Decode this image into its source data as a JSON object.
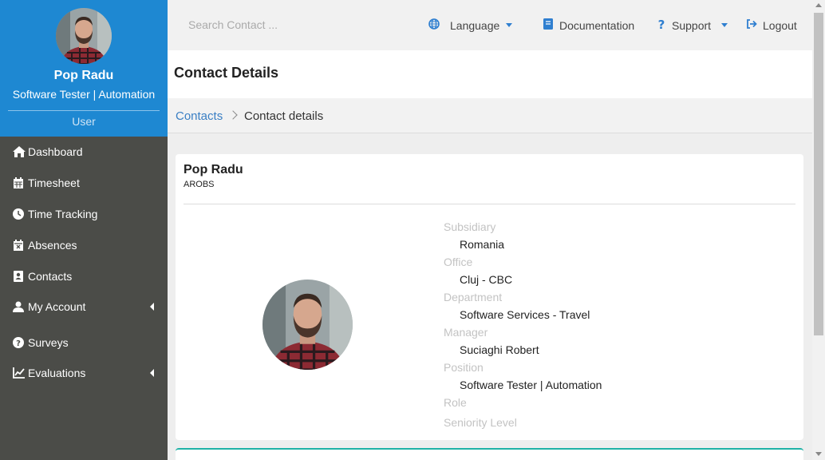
{
  "user": {
    "name": "Pop Radu",
    "role": "Software Tester | Automation",
    "type": "User"
  },
  "sidebar": {
    "items": [
      {
        "label": "Dashboard",
        "icon": "home-icon"
      },
      {
        "label": "Timesheet",
        "icon": "calendar-icon"
      },
      {
        "label": "Time Tracking",
        "icon": "clock-icon"
      },
      {
        "label": "Absences",
        "icon": "calendar-x-icon"
      },
      {
        "label": "Contacts",
        "icon": "address-book-icon"
      },
      {
        "label": "My Account",
        "icon": "user-icon",
        "expandable": true
      },
      {
        "label": "Surveys",
        "icon": "question-circle-icon"
      },
      {
        "label": "Evaluations",
        "icon": "line-chart-icon",
        "expandable": true
      }
    ]
  },
  "topbar": {
    "search_placeholder": "Search Contact ...",
    "language_label": "Language",
    "documentation_label": "Documentation",
    "support_label": "Support",
    "logout_label": "Logout"
  },
  "page": {
    "title": "Contact Details"
  },
  "breadcrumb": {
    "parent": "Contacts",
    "current": "Contact details"
  },
  "contact": {
    "name": "Pop Radu",
    "company": "AROBS",
    "fields": {
      "subsidiary_label": "Subsidiary",
      "subsidiary_value": "Romania",
      "office_label": "Office",
      "office_value": "Cluj - CBC",
      "department_label": "Department",
      "department_value": "Software Services - Travel",
      "manager_label": "Manager",
      "manager_value": "Suciaghi Robert",
      "position_label": "Position",
      "position_value": "Software Tester | Automation",
      "role_label": "Role",
      "seniority_label": "Seniority Level"
    }
  },
  "colors": {
    "sidebar_bg": "#4b4c48",
    "profile_bg": "#1e88d2",
    "link": "#3a7fc4",
    "icon_accent": "#2f7fd0",
    "card_accent": "#20b2a6"
  }
}
